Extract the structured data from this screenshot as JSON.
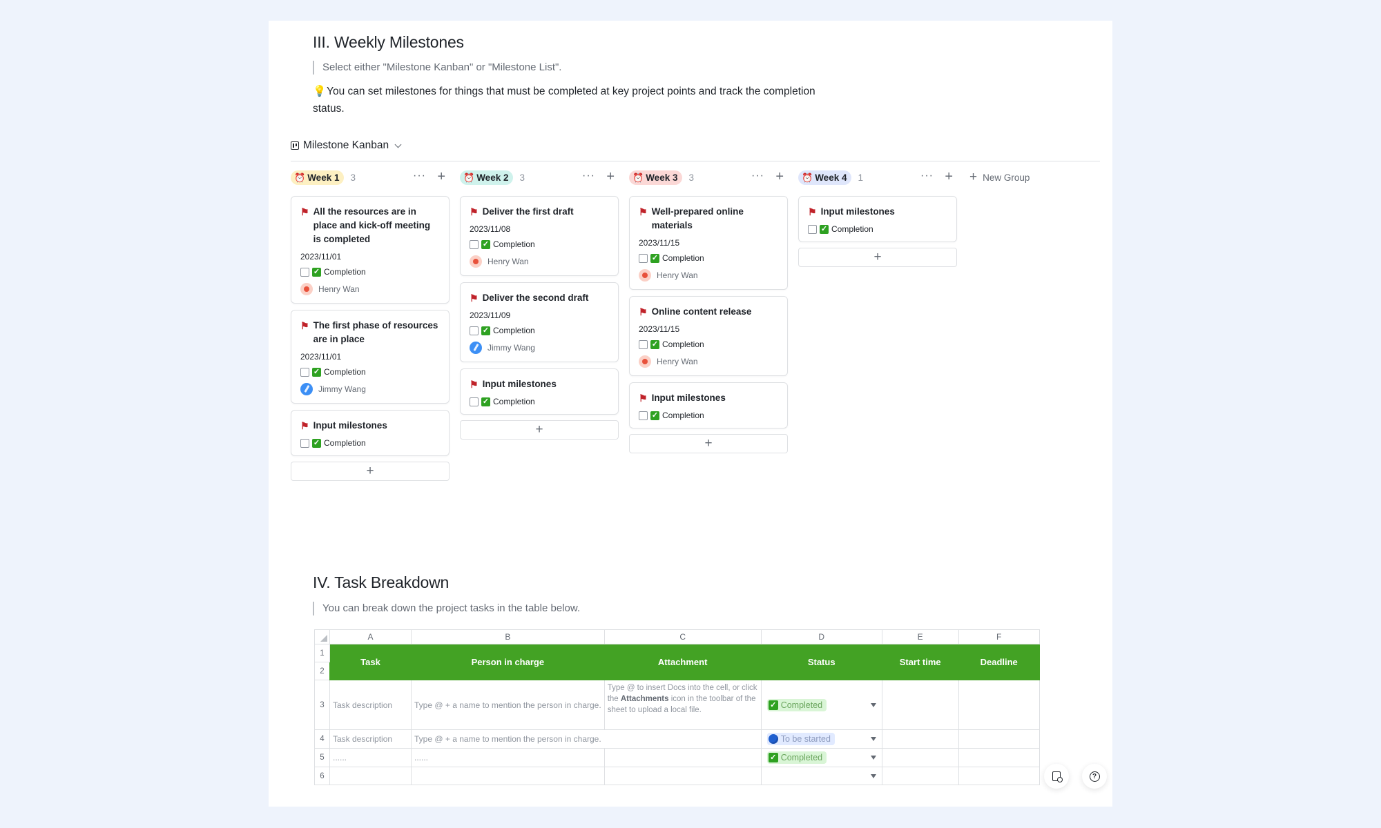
{
  "milestones": {
    "title": "III. Weekly Milestones",
    "quote": "Select either \"Milestone Kanban\" or \"Milestone List\".",
    "tip": "You can set milestones for things that must be completed at key project points and track the completion status.",
    "view_label": "Milestone Kanban",
    "new_group": "New Group",
    "columns": [
      {
        "label": "Week 1",
        "count": "3",
        "color": "#fdf0c2",
        "cards": [
          {
            "title": "All the resources are in place and kick-off meeting is completed",
            "date": "2023/11/01",
            "completion": "Completion",
            "person": "Henry Wan"
          },
          {
            "title": "The first phase of resources are in place",
            "date": "2023/11/01",
            "completion": "Completion",
            "person": "Jimmy Wang"
          },
          {
            "title": "Input milestones",
            "completion": "Completion"
          }
        ]
      },
      {
        "label": "Week 2",
        "count": "3",
        "color": "#cff2ec",
        "cards": [
          {
            "title": "Deliver the first draft",
            "date": "2023/11/08",
            "completion": "Completion",
            "person": "Henry Wan"
          },
          {
            "title": "Deliver the second draft",
            "date": "2023/11/09",
            "completion": "Completion",
            "person": "Jimmy Wang"
          },
          {
            "title": "Input milestones",
            "completion": "Completion"
          }
        ]
      },
      {
        "label": "Week 3",
        "count": "3",
        "color": "#fbd8d6",
        "cards": [
          {
            "title": "Well-prepared online materials",
            "date": "2023/11/15",
            "completion": "Completion",
            "person": "Henry Wan"
          },
          {
            "title": "Online content release",
            "date": "2023/11/15",
            "completion": "Completion",
            "person": "Henry Wan"
          },
          {
            "title": "Input milestones",
            "completion": "Completion"
          }
        ]
      },
      {
        "label": "Week 4",
        "count": "1",
        "color": "#dfe6fb",
        "cards": [
          {
            "title": "Input milestones",
            "completion": "Completion"
          }
        ]
      }
    ]
  },
  "tasks": {
    "title": "IV. Task Breakdown",
    "quote": "You can break down the project tasks in the table below.",
    "col_letters": [
      "A",
      "B",
      "C",
      "D",
      "E",
      "F"
    ],
    "headers": [
      "Task",
      "Person in charge",
      "Attachment",
      "Status",
      "Start time",
      "Deadline"
    ],
    "row_numbers": [
      "1",
      "2",
      "3",
      "4",
      "5",
      "6"
    ],
    "rows": [
      {
        "task": "Task description",
        "person": "Type @ + a name to mention the person in charge.",
        "attachment_pre": "Type @ to insert Docs into the cell, or click the ",
        "attachment_bold": "Attachments",
        "attachment_post": " icon in the toolbar of the sheet to upload a local file.",
        "status": "Completed"
      },
      {
        "task": "Task description",
        "person": "Type @ + a name to mention the person in charge.",
        "status": "To be started"
      },
      {
        "task": "......",
        "person": "......",
        "status": "Completed"
      },
      {
        "task": "",
        "person": "",
        "status": ""
      }
    ]
  }
}
